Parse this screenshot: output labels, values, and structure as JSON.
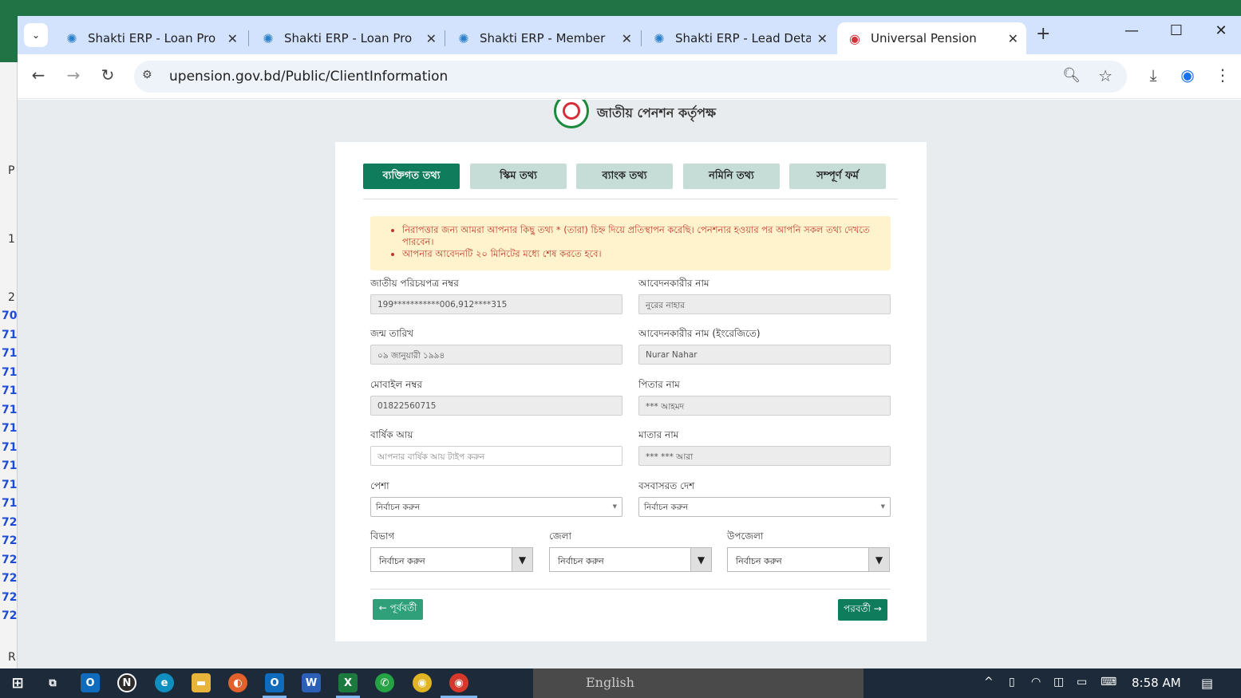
{
  "excel": {
    "row_heads": [
      "P",
      "1",
      "2"
    ],
    "row_numbers": [
      "70",
      "71",
      "71",
      "71",
      "71",
      "71",
      "71",
      "71",
      "71",
      "71",
      "71",
      "72",
      "72",
      "72",
      "72",
      "72",
      "72"
    ],
    "bottom_letter": "R"
  },
  "browser": {
    "tabs": [
      {
        "title": "Shakti ERP - Loan Propos",
        "active": false
      },
      {
        "title": "Shakti ERP - Loan Propos",
        "active": false
      },
      {
        "title": "Shakti ERP - Member Le",
        "active": false
      },
      {
        "title": "Shakti ERP - Lead Details",
        "active": false
      },
      {
        "title": "Universal Pension",
        "active": true
      }
    ],
    "url": "upension.gov.bd/Public/ClientInformation"
  },
  "page": {
    "org_name": "জাতীয় পেনশন কর্তৃপক্ষ",
    "steps": [
      "ব্যক্তিগত তথ্য",
      "স্কিম তথ্য",
      "ব্যাংক তথ্য",
      "নমিনি তথ্য",
      "সম্পূর্ণ ফর্ম"
    ],
    "notices": [
      "নিরাপত্তার জন্য আমরা আপনার কিছু তথ্য * (তারা) চিহ্ন দিয়ে প্রতিস্থাপন করেছি। পেনশনার হওয়ার পর আপনি সকল তথ্য দেখতে পারবেন।",
      "আপনার আবেদনটি ২০ মিনিটের মধ্যে শেষ করতে হবে।"
    ],
    "fields": {
      "nid_label": "জাতীয় পরিচয়পত্র নম্বর",
      "nid_value": "199***********006,912****315",
      "name_label": "আবেদনকারীর নাম",
      "name_value": "নুরের নাহার",
      "dob_label": "জন্ম তারিখ",
      "dob_value": "০৯ জানুয়ারী ১৯৯৪",
      "name_en_label": "আবেদনকারীর নাম (ইংরেজিতে)",
      "name_en_value": "Nurar Nahar",
      "mobile_label": "মোবাইল নম্বর",
      "mobile_value": "01822560715",
      "father_label": "পিতার নাম",
      "father_value": "*** আহমদ",
      "income_label": "বার্ষিক আয়",
      "income_placeholder": "আপনার বার্ষিক আয় টাইপ করুন",
      "mother_label": "মাতার নাম",
      "mother_value": "*** *** আরা",
      "occupation_label": "পেশা",
      "occupation_value": "নির্বাচন করুন",
      "country_label": "বসবাসরত দেশ",
      "country_value": "নির্বাচন করুন",
      "division_label": "বিভাগ",
      "division_value": "নির্বাচন করুন",
      "district_label": "জেলা",
      "district_value": "নির্বাচন করুন",
      "upazila_label": "উপজেলা",
      "upazila_value": "নির্বাচন করুন"
    },
    "prev_label": "← পূর্ববর্তী",
    "next_label": "পরবর্তী →"
  },
  "taskbar": {
    "language": "English",
    "time": "8:58 AM"
  }
}
